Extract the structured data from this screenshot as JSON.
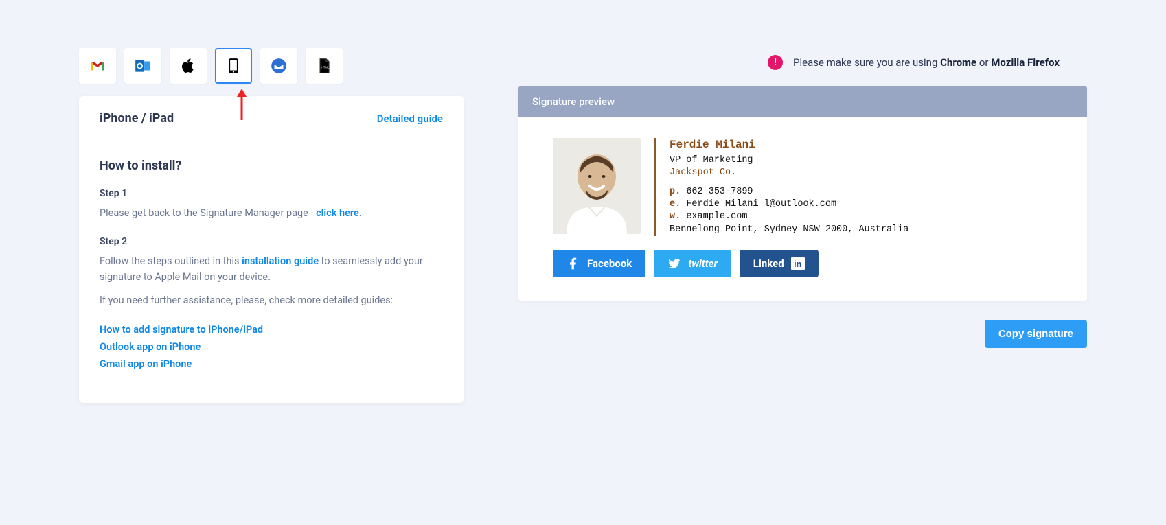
{
  "tabs": [
    "gmail-icon",
    "outlook-icon",
    "apple-icon",
    "ipad-icon",
    "thunderbird-icon",
    "html-icon"
  ],
  "panel": {
    "title": "iPhone / iPad",
    "detailed": "Detailed guide",
    "install_header": "How to install?",
    "step1_label": "Step 1",
    "step1_text_pre": "Please get back to the Signature Manager page - ",
    "step1_link": "click here",
    "step1_text_post": ".",
    "step2_label": "Step 2",
    "step2_text_pre": "Follow the steps outlined in this ",
    "step2_link": "installation guide",
    "step2_text_post": " to seamlessly add your signature to Apple Mail on your device.",
    "assist_text": "If you need further assistance, please, check more detailed guides:",
    "help_links": [
      "How to add signature to iPhone/iPad",
      "Outlook app on iPhone",
      "Gmail app on iPhone"
    ]
  },
  "notice": {
    "pre": "Please make sure you are using ",
    "chrome": "Chrome",
    "mid": " or ",
    "firefox": "Mozilla Firefox"
  },
  "preview": {
    "header": "Signature preview",
    "name": "Ferdie Milani",
    "title": "VP of Marketing",
    "company": "Jackspot Co.",
    "phone_label": "p.",
    "phone": "662-353-7899",
    "email_label": "e.",
    "email": "Ferdie Milani l@outlook.com",
    "web_label": "w.",
    "web": "example.com",
    "address": "Bennelong Point, Sydney NSW 2000, Australia",
    "social": {
      "facebook": "Facebook",
      "twitter": "twitter",
      "linkedin": "Linked"
    }
  },
  "copy_button": "Copy signature"
}
